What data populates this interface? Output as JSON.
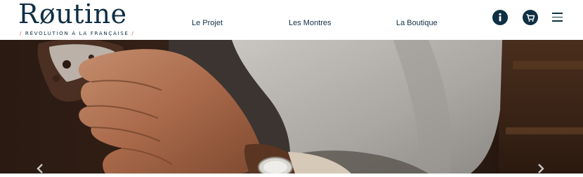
{
  "brand": {
    "logo_text": "Røutine",
    "tagline": "RÉVOLUTION À LA FRANÇAISE",
    "tag_slash": "/"
  },
  "nav": {
    "items": [
      {
        "label": "Le Projet"
      },
      {
        "label": "Les Montres"
      },
      {
        "label": "La Boutique"
      }
    ]
  },
  "header_icons": {
    "info": "info-icon",
    "cart": "cart-icon",
    "menu": "menu-icon"
  },
  "colors": {
    "brand": "#0f2f43",
    "accent": "#d6453c"
  }
}
